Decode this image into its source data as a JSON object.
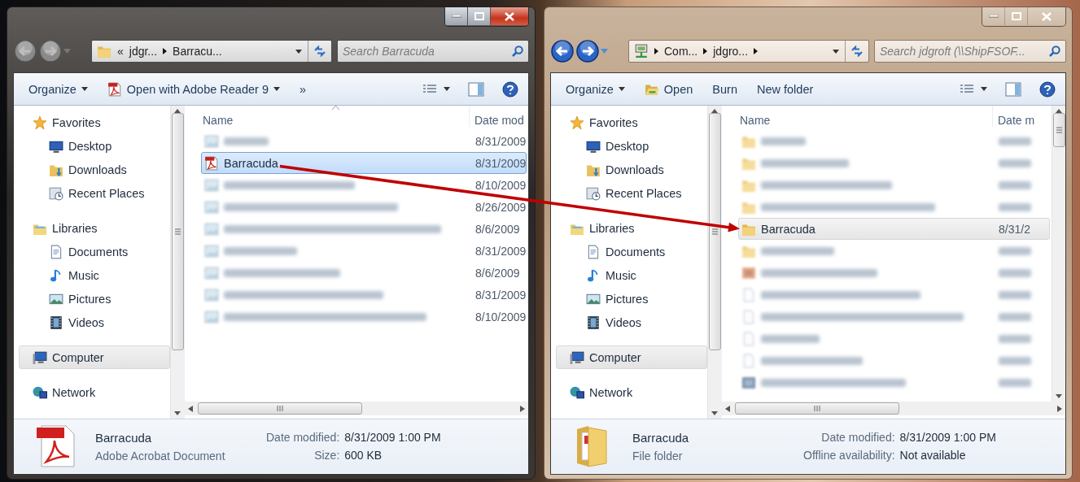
{
  "windows": [
    {
      "active": true,
      "nav_enabled": false,
      "address": {
        "kind": "folder",
        "crumbs": [
          {
            "text": "«",
            "kind": "overflow"
          },
          {
            "text": "jdgr...",
            "kind": "crumb"
          },
          {
            "text": "Barracu...",
            "kind": "current"
          }
        ]
      },
      "search": {
        "placeholder": "Search Barracuda"
      },
      "toolbar": [
        {
          "label": "Organize",
          "kind": "menu"
        },
        {
          "label": "Open with Adobe Reader 9",
          "kind": "open-with"
        },
        {
          "label": "»",
          "kind": "overflow"
        }
      ],
      "sidebar": [
        {
          "label": "Favorites",
          "kind": "favorites",
          "selected": false,
          "children": [
            {
              "label": "Desktop",
              "kind": "desktop",
              "selected": false
            },
            {
              "label": "Downloads",
              "kind": "downloads",
              "selected": false
            },
            {
              "label": "Recent Places",
              "kind": "recent",
              "selected": false
            }
          ]
        },
        {
          "label": "Libraries",
          "kind": "libraries",
          "selected": false,
          "children": [
            {
              "label": "Documents",
              "kind": "documents",
              "selected": false
            },
            {
              "label": "Music",
              "kind": "music",
              "selected": false
            },
            {
              "label": "Pictures",
              "kind": "pictures",
              "selected": false
            },
            {
              "label": "Videos",
              "kind": "videos",
              "selected": false
            }
          ]
        },
        {
          "label": "Computer",
          "kind": "computer",
          "selected": true
        },
        {
          "label": "Network",
          "kind": "network",
          "selected": false
        }
      ],
      "columns": [
        {
          "label": "Name",
          "sorted": true
        },
        {
          "label": "Date mod",
          "sorted": false
        }
      ],
      "rows": [
        {
          "kind": "image",
          "date": "8/31/2009",
          "selected": false,
          "hover": false
        },
        {
          "kind": "pdf",
          "name": "Barracuda",
          "date": "8/31/2009",
          "selected": true,
          "hover": false
        },
        {
          "kind": "image",
          "date": "8/10/2009",
          "selected": false,
          "hover": false
        },
        {
          "kind": "image",
          "date": "8/26/2009",
          "selected": false,
          "hover": false
        },
        {
          "kind": "image",
          "date": "8/6/2009",
          "selected": false,
          "hover": false
        },
        {
          "kind": "image",
          "date": "8/31/2009",
          "selected": false,
          "hover": false
        },
        {
          "kind": "image",
          "date": "8/6/2009",
          "selected": false,
          "hover": false
        },
        {
          "kind": "image",
          "date": "8/31/2009",
          "selected": false,
          "hover": false
        },
        {
          "kind": "image",
          "date": "8/10/2009",
          "selected": false,
          "hover": false
        }
      ],
      "details": {
        "kind": "pdf",
        "name": "Barracuda",
        "type": "Adobe Acrobat Document",
        "fields": [
          {
            "label": "Date modified:",
            "value": "8/31/2009 1:00 PM"
          },
          {
            "label": "Size:",
            "value": "600 KB"
          }
        ]
      }
    },
    {
      "active": false,
      "nav_enabled": true,
      "address": {
        "kind": "network",
        "crumbs": [
          {
            "text": "Com...",
            "kind": "crumb"
          },
          {
            "text": "jdgro...",
            "kind": "crumb"
          }
        ]
      },
      "search": {
        "placeholder": "Search jdgroft (\\\\ShipFSOF..."
      },
      "toolbar": [
        {
          "label": "Organize",
          "kind": "menu"
        },
        {
          "label": "Open",
          "kind": "open"
        },
        {
          "label": "Burn",
          "kind": "command"
        },
        {
          "label": "New folder",
          "kind": "command"
        }
      ],
      "sidebar": [
        {
          "label": "Favorites",
          "kind": "favorites",
          "selected": false,
          "children": [
            {
              "label": "Desktop",
              "kind": "desktop",
              "selected": false
            },
            {
              "label": "Downloads",
              "kind": "downloads",
              "selected": false
            },
            {
              "label": "Recent Places",
              "kind": "recent",
              "selected": false
            }
          ]
        },
        {
          "label": "Libraries",
          "kind": "libraries",
          "selected": false,
          "children": [
            {
              "label": "Documents",
              "kind": "documents",
              "selected": false
            },
            {
              "label": "Music",
              "kind": "music",
              "selected": false
            },
            {
              "label": "Pictures",
              "kind": "pictures",
              "selected": false
            },
            {
              "label": "Videos",
              "kind": "videos",
              "selected": false
            }
          ]
        },
        {
          "label": "Computer",
          "kind": "computer",
          "selected": true
        },
        {
          "label": "Network",
          "kind": "network",
          "selected": false
        }
      ],
      "columns": [
        {
          "label": "Name",
          "sorted": false
        },
        {
          "label": "Date m",
          "sorted": false
        }
      ],
      "rows": [
        {
          "kind": "folder",
          "selected": false,
          "hover": false
        },
        {
          "kind": "folder",
          "selected": false,
          "hover": false
        },
        {
          "kind": "folder",
          "selected": false,
          "hover": false
        },
        {
          "kind": "folder",
          "selected": false,
          "hover": false
        },
        {
          "kind": "folder",
          "name": "Barracuda",
          "date": "8/31/2",
          "selected": false,
          "hover": true
        },
        {
          "kind": "folder",
          "selected": false,
          "hover": false
        },
        {
          "kind": "photo",
          "selected": false,
          "hover": false
        },
        {
          "kind": "doc",
          "selected": false,
          "hover": false
        },
        {
          "kind": "doc",
          "selected": false,
          "hover": false
        },
        {
          "kind": "doc",
          "selected": false,
          "hover": false
        },
        {
          "kind": "doc",
          "selected": false,
          "hover": false
        },
        {
          "kind": "dark-image",
          "selected": false,
          "hover": false
        }
      ],
      "details": {
        "kind": "folder",
        "name": "Barracuda",
        "type": "File folder",
        "fields": [
          {
            "label": "Date modified:",
            "value": "8/31/2009 1:00 PM"
          },
          {
            "label": "Offline availability:",
            "value": "Not available"
          }
        ]
      }
    }
  ],
  "drag_arrow": true
}
